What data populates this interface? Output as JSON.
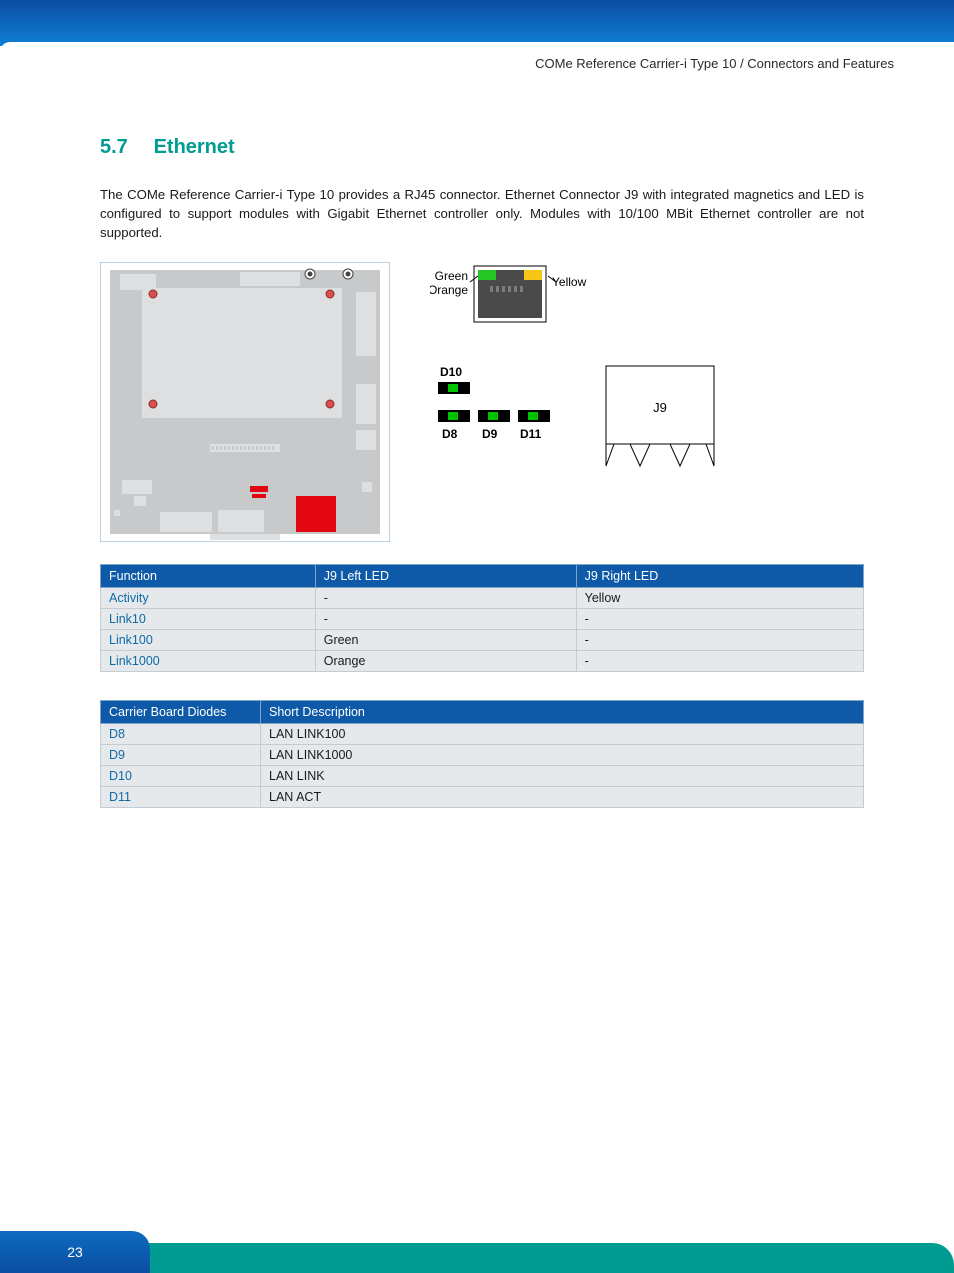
{
  "header": {
    "breadcrumb": "COMe Reference Carrier-i Type 10 / Connectors and Features"
  },
  "section": {
    "number": "5.7",
    "title": "Ethernet",
    "paragraph": "The COMe Reference Carrier-i Type 10 provides a RJ45 connector. Ethernet Connector J9 with integrated magnetics and LED is configured to support modules with Gigabit Ethernet controller only. Modules with 10/100 MBit Ethernet controller are not supported."
  },
  "rj45_labels": {
    "left_top": "Green",
    "left_bottom": "Orange",
    "right": "Yellow"
  },
  "diode_diagram": {
    "d10": "D10",
    "d8": "D8",
    "d9": "D9",
    "d11": "D11"
  },
  "connector_label": "J9",
  "table1": {
    "headers": [
      "Function",
      "J9 Left LED",
      "J9 Right LED"
    ],
    "rows": [
      {
        "fn": "Activity",
        "left": "-",
        "right": "Yellow"
      },
      {
        "fn": "Link10",
        "left": "-",
        "right": "-"
      },
      {
        "fn": "Link100",
        "left": "Green",
        "right": "-"
      },
      {
        "fn": "Link1000",
        "left": "Orange",
        "right": "-"
      }
    ]
  },
  "table2": {
    "headers": [
      "Carrier Board Diodes",
      "Short Description"
    ],
    "rows": [
      {
        "d": "D8",
        "desc": "LAN LINK100"
      },
      {
        "d": "D9",
        "desc": "LAN LINK1000"
      },
      {
        "d": "D10",
        "desc": "LAN LINK"
      },
      {
        "d": "D11",
        "desc": "LAN ACT"
      }
    ]
  },
  "footer": {
    "page": "23"
  }
}
